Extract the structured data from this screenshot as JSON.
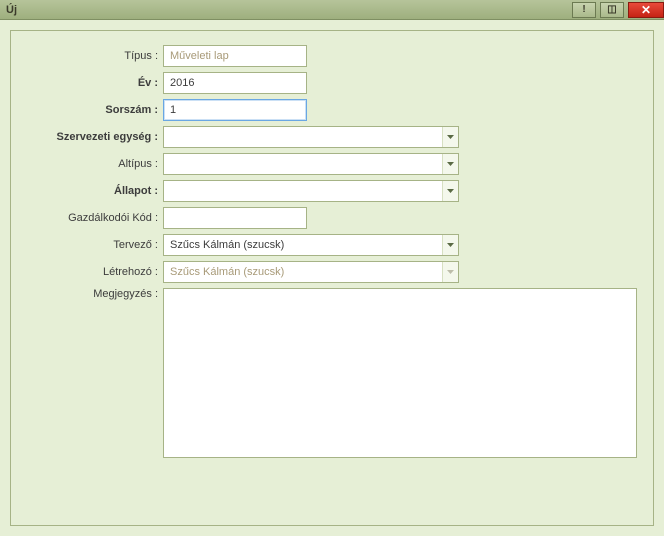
{
  "window": {
    "title": "Új"
  },
  "icons": {
    "help": "!",
    "pin": "◫",
    "close": "✕"
  },
  "labels": {
    "tipus": "Típus :",
    "ev": "Év :",
    "sorszam": "Sorszám :",
    "szervezet": "Szervezeti egység :",
    "altipus": "Altípus :",
    "allapot": "Állapot :",
    "gazdkod": "Gazdálkodói Kód :",
    "tervezo": "Tervező :",
    "letrehozo": "Létrehozó :",
    "megjegyzes": "Megjegyzés :"
  },
  "values": {
    "tipus": "Műveleti lap",
    "ev": "2016",
    "sorszam": "1",
    "szervezet": "",
    "altipus": "",
    "allapot": "",
    "gazdkod": "",
    "tervezo": "Szűcs Kálmán (szucsk)",
    "letrehozo": "Szűcs Kálmán (szucsk)",
    "megjegyzes": ""
  }
}
